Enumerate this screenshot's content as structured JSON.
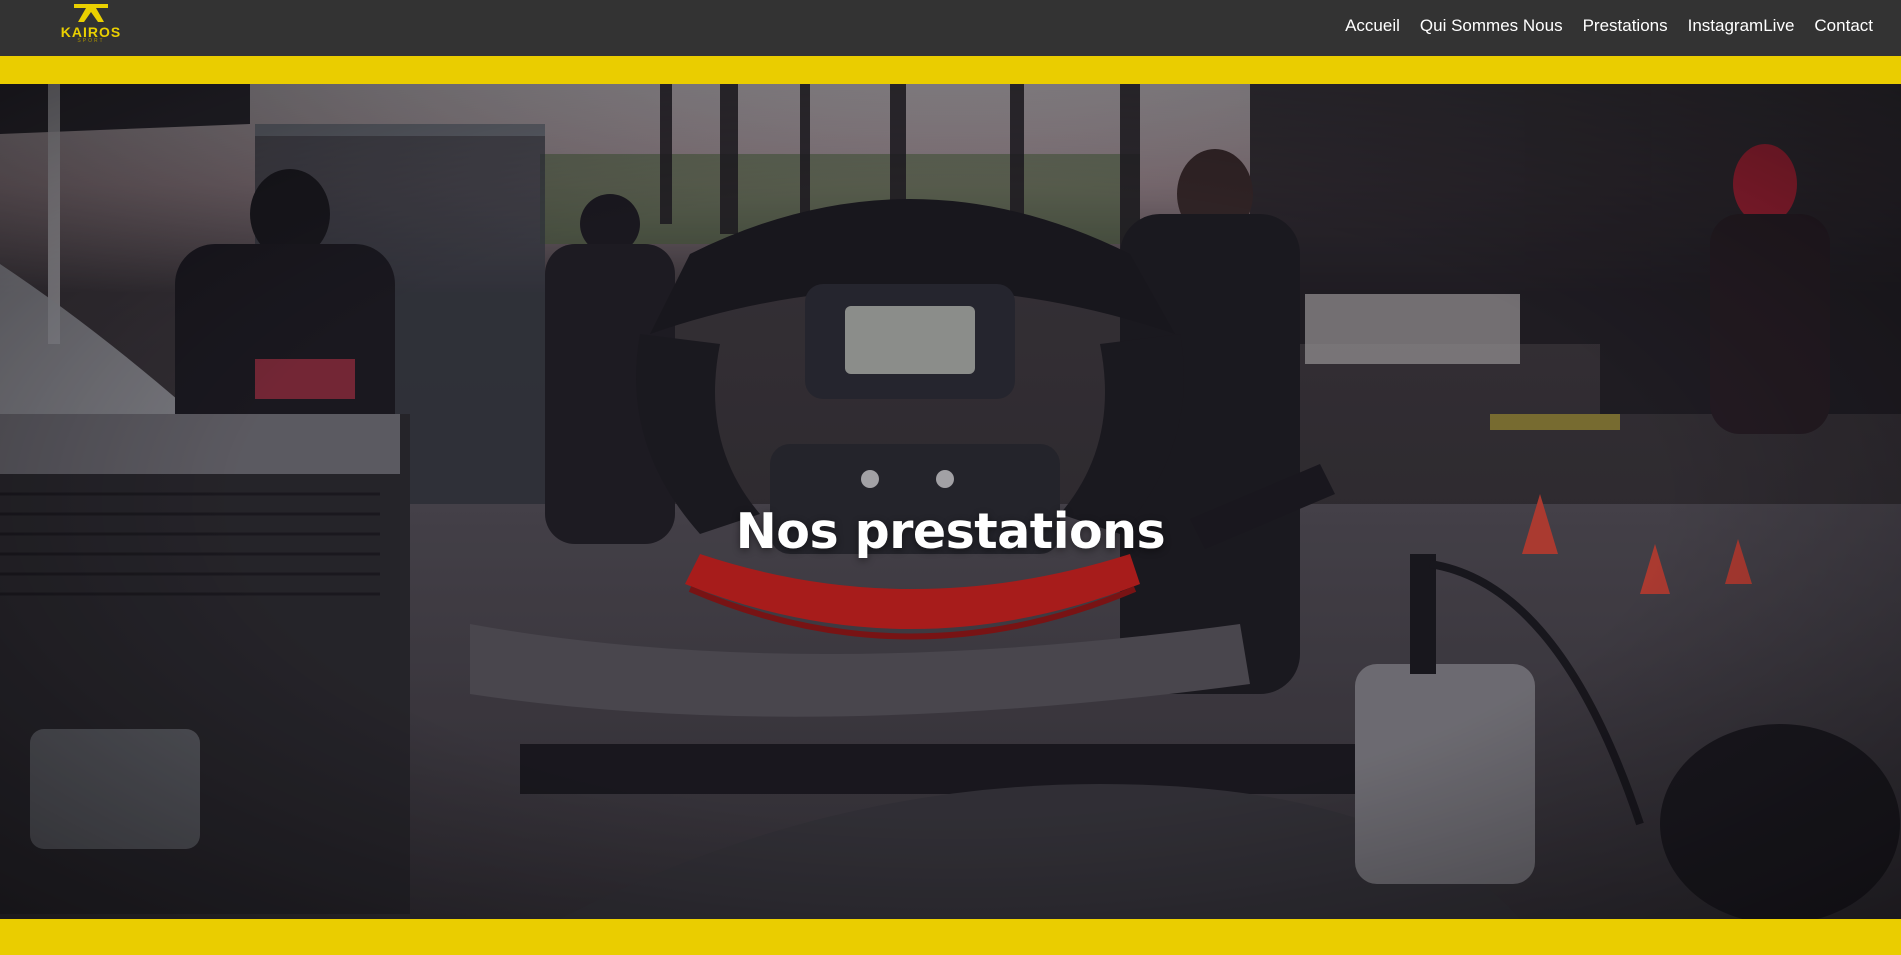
{
  "site": {
    "logo_text": "KAIROS",
    "logo_sub": "SPORT"
  },
  "nav": {
    "items": [
      {
        "label": "Accueil"
      },
      {
        "label": "Qui Sommes Nous"
      },
      {
        "label": "Prestations"
      },
      {
        "label": "InstagramLive"
      },
      {
        "label": "Contact"
      }
    ]
  },
  "hero": {
    "title": "Nos prestations",
    "background": "karting-steering-wheel-photo"
  },
  "colors": {
    "nav_bg": "#333333",
    "accent_yellow": "#eacd00",
    "steering_red": "#e0201c"
  }
}
